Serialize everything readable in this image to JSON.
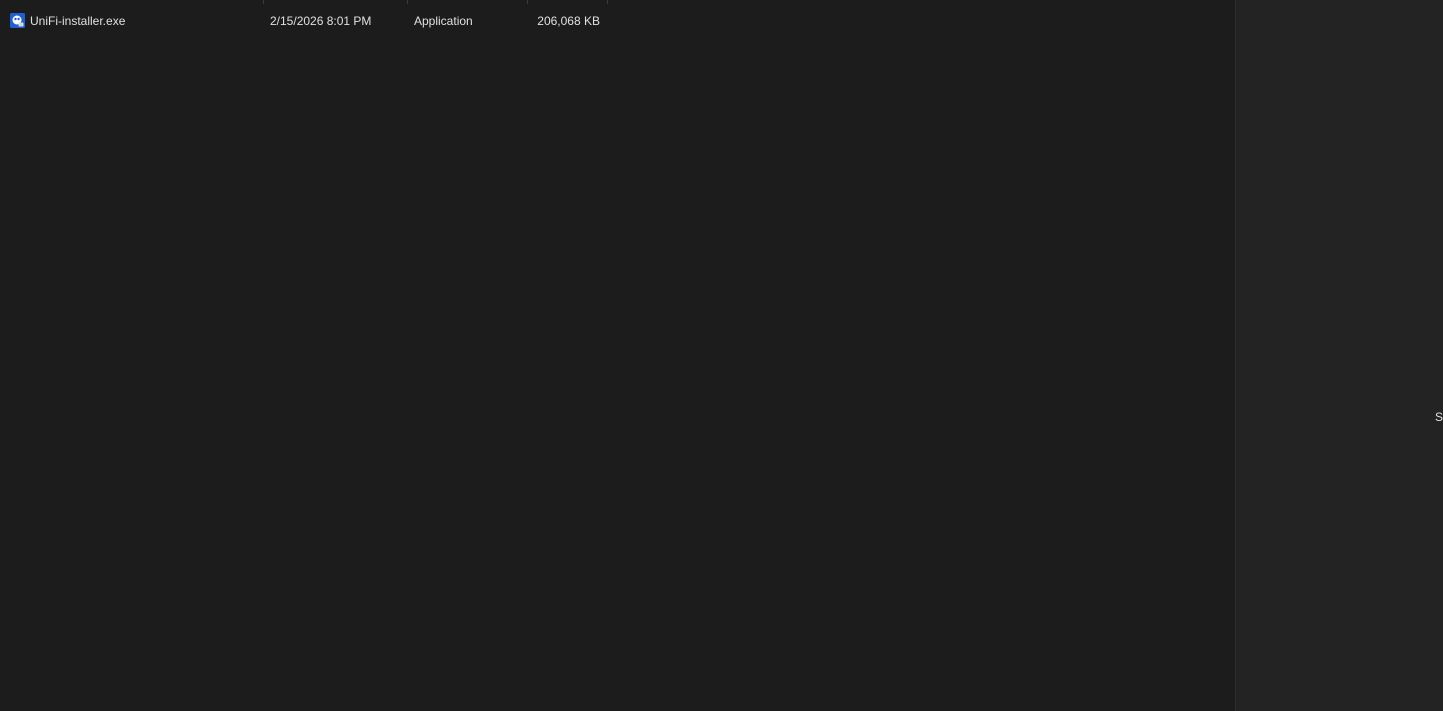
{
  "file_list": {
    "rows": [
      {
        "icon": "installer-app-icon",
        "name": "UniFi-installer.exe",
        "date_modified": "2/15/2026 8:01 PM",
        "type": "Application",
        "size": "206,068 KB"
      }
    ]
  },
  "details_pane": {
    "hint_text": "Se"
  },
  "colors": {
    "background": "#1c1c1c",
    "details_background": "#232323",
    "icon_accent": "#1e5fd6"
  }
}
